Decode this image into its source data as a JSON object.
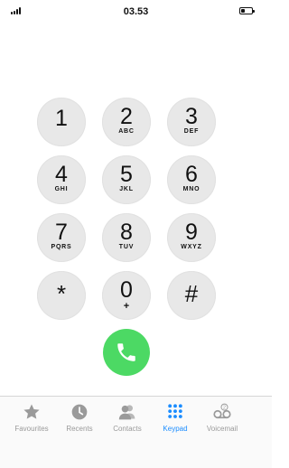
{
  "status_bar": {
    "time": "03.53"
  },
  "keypad": {
    "keys": [
      {
        "digit": "1",
        "letters": ""
      },
      {
        "digit": "2",
        "letters": "ABC"
      },
      {
        "digit": "3",
        "letters": "DEF"
      },
      {
        "digit": "4",
        "letters": "GHI"
      },
      {
        "digit": "5",
        "letters": "JKL"
      },
      {
        "digit": "6",
        "letters": "MNO"
      },
      {
        "digit": "7",
        "letters": "PQRS"
      },
      {
        "digit": "8",
        "letters": "TUV"
      },
      {
        "digit": "9",
        "letters": "WXYZ"
      },
      {
        "digit": "*",
        "letters": ""
      },
      {
        "digit": "0",
        "letters": "+"
      },
      {
        "digit": "#",
        "letters": ""
      }
    ]
  },
  "call": {
    "icon": "phone-icon",
    "color": "#4cd964"
  },
  "tab_bar": {
    "active_color": "#1a8cff",
    "inactive_color": "#9a9a9a",
    "tabs": [
      {
        "label": "Favourites",
        "icon": "star-icon"
      },
      {
        "label": "Recents",
        "icon": "clock-icon"
      },
      {
        "label": "Contacts",
        "icon": "contacts-icon"
      },
      {
        "label": "Keypad",
        "icon": "keypad-icon"
      },
      {
        "label": "Voicemail",
        "icon": "voicemail-icon"
      }
    ]
  }
}
